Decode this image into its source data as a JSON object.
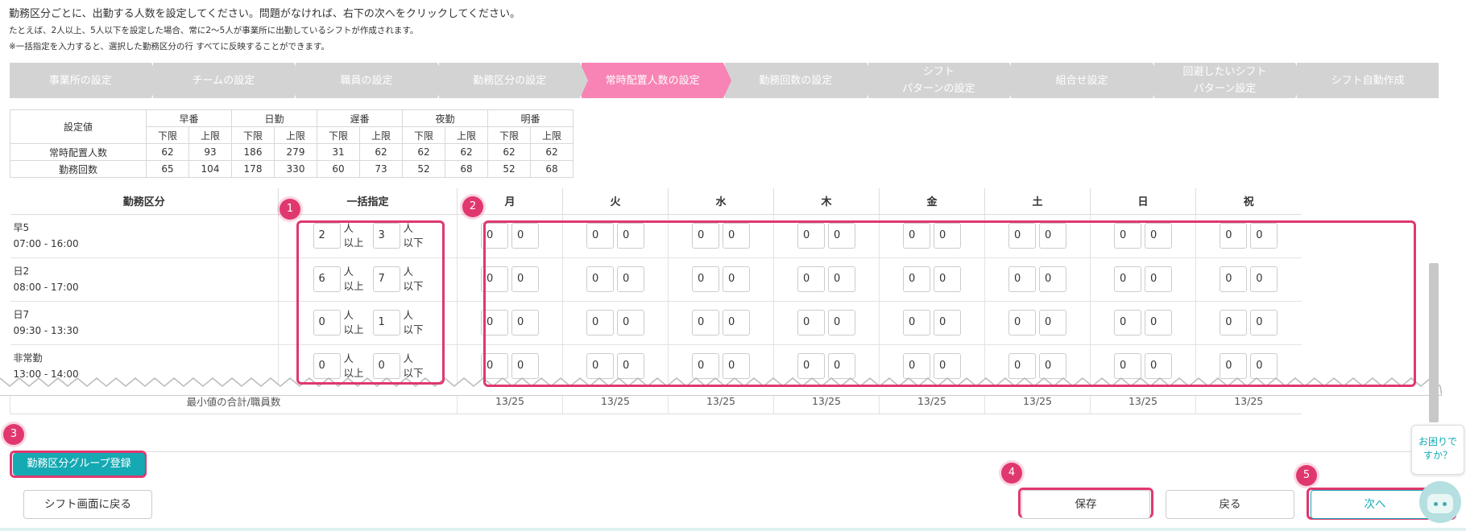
{
  "intro": {
    "line1": "勤務区分ごとに、出勤する人数を設定してください。問題がなければ、右下の次へをクリックしてください。",
    "line2": "たとえば、2人以上、5人以下を設定した場合、常に2〜5人が事業所に出勤しているシフトが作成されます。",
    "line3": "※一括指定を入力すると、選択した勤務区分の行 すべてに反映することができます。"
  },
  "steps": [
    {
      "label": "事業所の設定",
      "active": false
    },
    {
      "label": "チームの設定",
      "active": false
    },
    {
      "label": "職員の設定",
      "active": false
    },
    {
      "label": "勤務区分の設定",
      "active": false
    },
    {
      "label": "常時配置人数の設定",
      "active": true
    },
    {
      "label": "勤務回数の設定",
      "active": false
    },
    {
      "label": "シフト\nパターンの設定",
      "active": false
    },
    {
      "label": "組合せ設定",
      "active": false
    },
    {
      "label": "回避したいシフト\nパターン設定",
      "active": false
    },
    {
      "label": "シフト自動作成",
      "active": false
    }
  ],
  "summary": {
    "corner": "設定値",
    "shifts": [
      "早番",
      "日勤",
      "遅番",
      "夜勤",
      "明番"
    ],
    "lower": "下限",
    "upper": "上限",
    "rows": [
      {
        "label": "常時配置人数",
        "values": [
          "62",
          "93",
          "186",
          "279",
          "31",
          "62",
          "62",
          "62",
          "62",
          "62"
        ]
      },
      {
        "label": "勤務回数",
        "values": [
          "65",
          "104",
          "178",
          "330",
          "60",
          "73",
          "52",
          "68",
          "52",
          "68"
        ]
      }
    ]
  },
  "grid": {
    "col_shift": "勤務区分",
    "col_bulk": "一括指定",
    "days": [
      "月",
      "火",
      "水",
      "木",
      "金",
      "土",
      "日",
      "祝"
    ],
    "unit_min": "人\n以上",
    "unit_max": "人\n以下",
    "rows": [
      {
        "name": "早5",
        "time": "07:00 - 16:00",
        "bulk_min": "2",
        "bulk_max": "3"
      },
      {
        "name": "日2",
        "time": "08:00 - 17:00",
        "bulk_min": "6",
        "bulk_max": "7"
      },
      {
        "name": "日7",
        "time": "09:30 - 13:30",
        "bulk_min": "0",
        "bulk_max": "1"
      },
      {
        "name": "非常勤",
        "time": "13:00 - 14:00",
        "bulk_min": "0",
        "bulk_max": "0"
      }
    ],
    "day_value": "0",
    "total_label": "最小値の合計/職員数",
    "total_value": "13/25"
  },
  "badges": [
    "1",
    "2",
    "3",
    "4",
    "5"
  ],
  "buttons": {
    "group_register": "勤務区分グループ登録",
    "back_to_shift": "シフト画面に戻る",
    "save": "保存",
    "back": "戻る",
    "next": "次へ"
  },
  "help": "お困りで\nすか？",
  "colors": {
    "accent_pink": "#f784b4",
    "highlight": "#e0386e",
    "teal": "#14a9b3",
    "inactive_step": "#d3d3d3"
  }
}
